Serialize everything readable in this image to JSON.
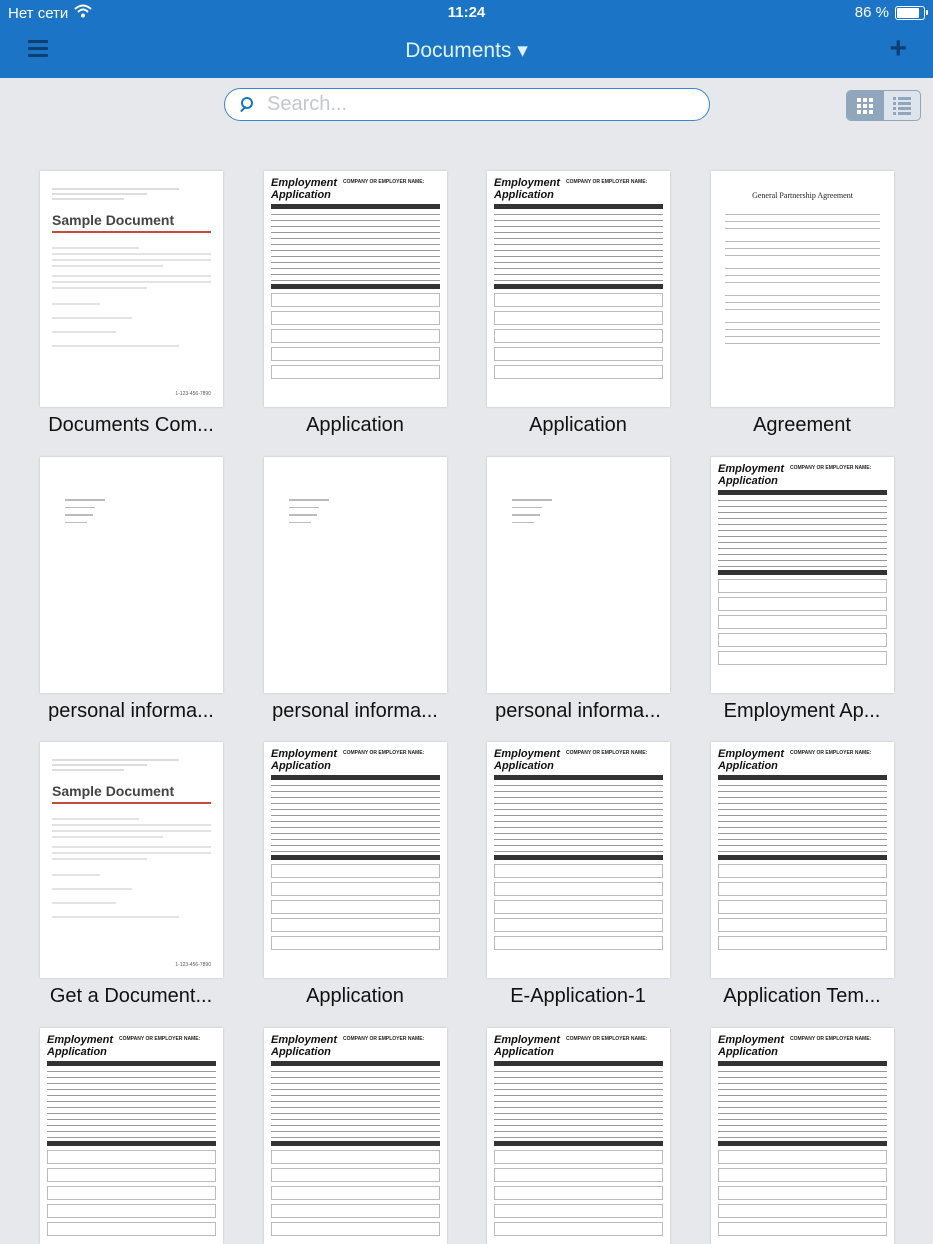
{
  "status_bar": {
    "carrier": "Нет сети",
    "time": "11:24",
    "battery_text": "86 %",
    "battery_level": 0.86
  },
  "nav": {
    "title": "Documents ▾"
  },
  "search": {
    "placeholder": "Search..."
  },
  "view_toggle": {
    "active": "grid"
  },
  "documents": [
    {
      "title": "Documents Com...",
      "thumb": "sample"
    },
    {
      "title": "Application",
      "thumb": "application"
    },
    {
      "title": "Application",
      "thumb": "application"
    },
    {
      "title": "Agreement",
      "thumb": "agreement"
    },
    {
      "title": "personal informa...",
      "thumb": "personal"
    },
    {
      "title": "personal informa...",
      "thumb": "personal"
    },
    {
      "title": "personal informa...",
      "thumb": "personal"
    },
    {
      "title": "Employment Ap...",
      "thumb": "application"
    },
    {
      "title": "Get a Document...",
      "thumb": "sample"
    },
    {
      "title": "Application",
      "thumb": "application"
    },
    {
      "title": "E-Application-1",
      "thumb": "application"
    },
    {
      "title": "Application Tem...",
      "thumb": "application"
    },
    {
      "title": "",
      "thumb": "application"
    },
    {
      "title": "",
      "thumb": "application"
    },
    {
      "title": "",
      "thumb": "application"
    },
    {
      "title": "",
      "thumb": "application"
    }
  ],
  "thumb_text": {
    "sample_title": "Sample Document",
    "sample_phone": "1-123-456-7890",
    "app_title_1": "Employment",
    "app_title_2": "Application",
    "app_company": "COMPANY OR EMPLOYER NAME:",
    "agreement_title": "General Partnership Agreement"
  }
}
